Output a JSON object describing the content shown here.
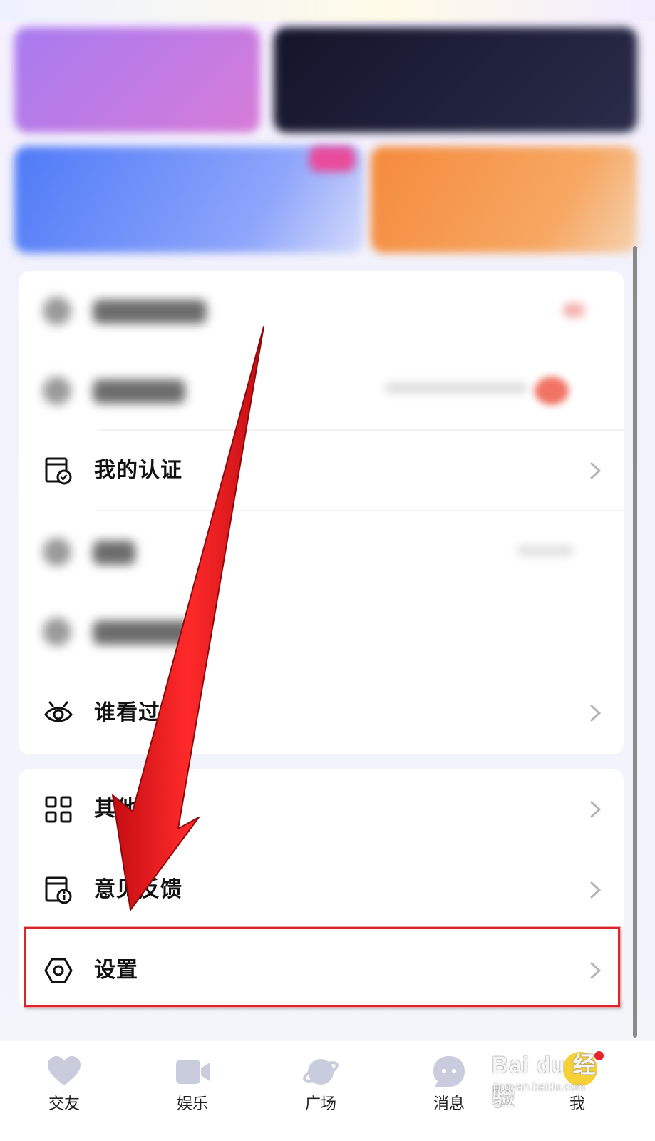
{
  "menu": {
    "certification_label": "我的认证",
    "viewers_label": "谁看过我",
    "other_features_label": "其他功能",
    "feedback_label": "意见反馈",
    "settings_label": "设置"
  },
  "tabbar": {
    "items": [
      {
        "label": "交友",
        "icon": "heart-icon"
      },
      {
        "label": "娱乐",
        "icon": "video-camera-icon"
      },
      {
        "label": "广场",
        "icon": "planet-icon"
      },
      {
        "label": "消息",
        "icon": "message-bubble-icon"
      },
      {
        "label": "我",
        "icon": "avatar-icon"
      }
    ]
  },
  "annotation": {
    "highlight_color": "#d8262c",
    "arrow_color": "#e8141b"
  },
  "watermark": {
    "main": "Bai du 经验",
    "sub": "jingyan.baidu.com"
  }
}
